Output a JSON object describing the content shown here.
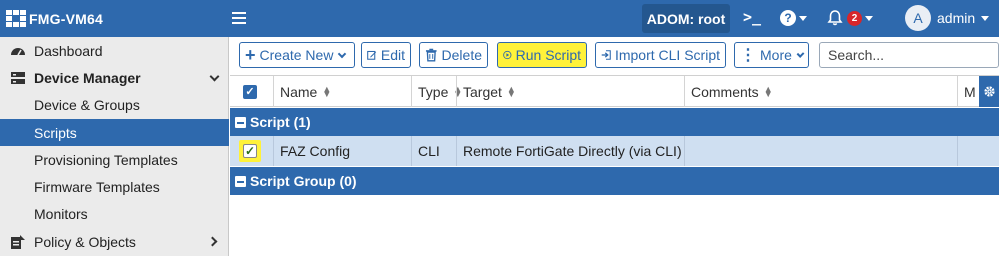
{
  "header": {
    "app_title": "FMG-VM64",
    "adom_label": "ADOM: root",
    "cli_icon_text": ">_",
    "help_icon_text": "?",
    "notification_count": "2",
    "user_initial": "A",
    "username": "admin"
  },
  "sidebar": {
    "items": [
      {
        "label": "Dashboard",
        "icon": "dashboard-icon"
      },
      {
        "label": "Device Manager",
        "icon": "device-manager-icon"
      },
      {
        "label": "Device & Groups"
      },
      {
        "label": "Scripts"
      },
      {
        "label": "Provisioning Templates"
      },
      {
        "label": "Firmware Templates"
      },
      {
        "label": "Monitors"
      },
      {
        "label": "Policy & Objects",
        "icon": "policy-objects-icon"
      }
    ],
    "active_item": "Scripts"
  },
  "toolbar": {
    "create_new": "Create New",
    "edit": "Edit",
    "delete": "Delete",
    "run_script": "Run Script",
    "import_cli_script": "Import CLI Script",
    "more": "More",
    "search_placeholder": "Search..."
  },
  "table": {
    "columns": [
      "Name",
      "Type",
      "Target",
      "Comments",
      "M"
    ],
    "groups": [
      {
        "label": "Script (1)"
      },
      {
        "label": "Script Group (0)"
      }
    ],
    "rows": [
      {
        "name": "FAZ Config",
        "type": "CLI",
        "target": "Remote FortiGate Directly (via CLI)",
        "comments": "",
        "selected": true
      }
    ]
  },
  "colors": {
    "brand_blue": "#2e69ad",
    "highlight_yellow": "#fff23a",
    "selected_row": "#cfdff1",
    "badge_red": "#d7262b"
  }
}
